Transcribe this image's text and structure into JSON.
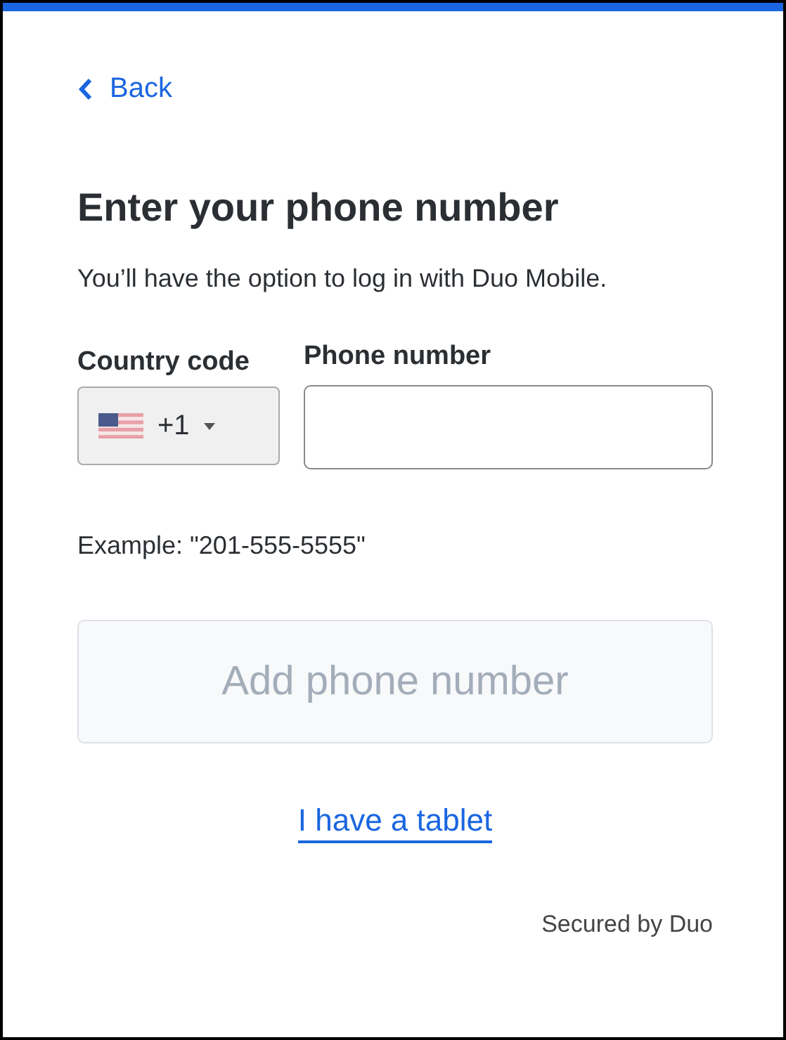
{
  "back_link": {
    "label": "Back"
  },
  "title": "Enter your phone number",
  "subtitle": "You’ll have the option to log in with Duo Mobile.",
  "country_code": {
    "label": "Country code",
    "value": "+1"
  },
  "phone_number": {
    "label": "Phone number"
  },
  "example": "Example: \"201-555-5555\"",
  "submit_button": {
    "label": "Add phone number",
    "disabled": true
  },
  "tablet_link": "I have a tablet",
  "footer": "Secured by Duo"
}
